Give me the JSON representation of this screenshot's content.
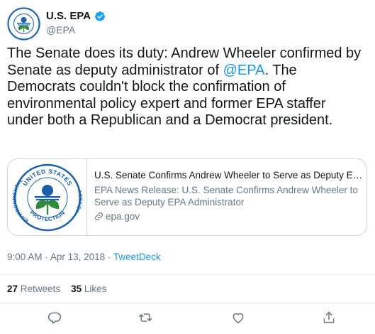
{
  "author": {
    "name": "U.S. EPA",
    "handle": "@EPA",
    "avatar_icon": "epa-logo-icon",
    "verified_icon": "verified-badge-icon"
  },
  "tweet": {
    "text_before": "The Senate does its duty: Andrew Wheeler confirmed by Senate as deputy administrator of ",
    "mention": "@EPA",
    "text_after": ". The Democrats couldn't block the confirmation of environmental policy expert and former EPA staffer under both a Republican and a Democrat president."
  },
  "card": {
    "title": "U.S. Senate Confirms Andrew Wheeler to Serve as Deputy EPA...",
    "description": "EPA News Release: U.S. Senate Confirms Andrew Wheeler to Serve as Deputy EPA Administrator",
    "domain": "epa.gov",
    "logo_text_top": "UNITED STATES",
    "logo_text_left": "ENVIRONMENTAL",
    "logo_text_right": "AGENCY",
    "logo_text_bottom": "PROTECTION"
  },
  "meta": {
    "time": "9:00 AM",
    "date": "Apr 13, 2018",
    "separator": "·",
    "source": "TweetDeck"
  },
  "stats": {
    "retweets_count": "27",
    "retweets_label": "Retweets",
    "likes_count": "35",
    "likes_label": "Likes"
  },
  "actions": [
    "reply-icon",
    "retweet-icon",
    "like-icon",
    "share-icon"
  ],
  "colors": {
    "link": "#1b95e0",
    "muted": "#657786",
    "border": "#ccd6dd",
    "epa_green": "#2e8b3c",
    "epa_blue": "#1a5fa8"
  }
}
